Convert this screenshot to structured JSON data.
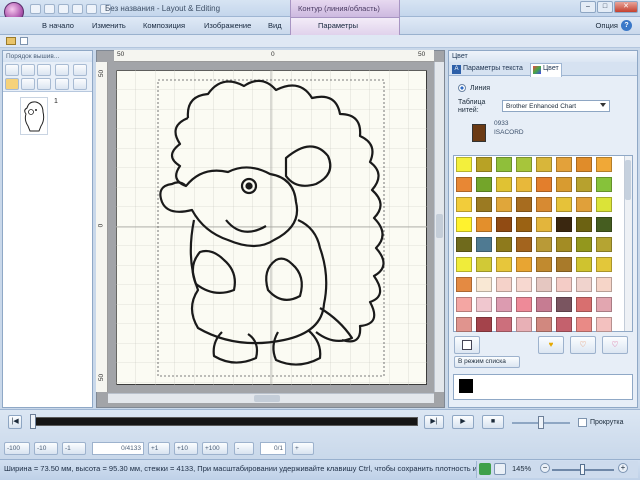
{
  "window": {
    "title": "Без названия - Layout & Editing",
    "context_tab_group": "Контур (линия/область)"
  },
  "ribbon": {
    "tabs": [
      "В начало",
      "Изменить",
      "Композиция",
      "Изображение",
      "Вид",
      "Параметры"
    ],
    "help_label": "Опция",
    "help_icon": "?"
  },
  "left_panel": {
    "title": "Порядок вышив...",
    "thumbnail_index": "1"
  },
  "rulers": {
    "top_labels": [
      "50",
      "0",
      "50"
    ],
    "left_labels": [
      "50",
      "0",
      "50"
    ]
  },
  "right_panel": {
    "title": "Цвет",
    "tabs": [
      "Параметры текста",
      "Цвет"
    ],
    "radio_label": "Линия",
    "thread_table_label": "Таблица нитей:",
    "thread_table_value": "Brother Enhanced Chart",
    "current_thread": {
      "code": "0933",
      "brand": "ISACORD",
      "color": "#6b3a14"
    },
    "list_mode_button": "В режим списка",
    "selected_color": "#000000",
    "palette": [
      "#f3ef3c",
      "#b8a225",
      "#8fbf3a",
      "#a7c53b",
      "#d8b63a",
      "#e3a13a",
      "#e08c2a",
      "#f0a837",
      "#e88734",
      "#73a52a",
      "#e0c233",
      "#e8b83a",
      "#e37e2c",
      "#d89b30",
      "#b7a12e",
      "#86c23a",
      "#f2cc3a",
      "#9b7a22",
      "#e0a63a",
      "#a76c1f",
      "#d78a32",
      "#e6c239",
      "#e0a03a",
      "#dbe338",
      "#fff22e",
      "#e38f2c",
      "#914b13",
      "#9b6213",
      "#e3b53c",
      "#3a2710",
      "#6c6212",
      "#455d20",
      "#6f6a1c",
      "#4f7a92",
      "#8e7a1c",
      "#a3641e",
      "#b99a37",
      "#a38c24",
      "#93971d",
      "#b5a432",
      "#f0ec3a",
      "#d1c936",
      "#e7c63b",
      "#e8a532",
      "#c18a2f",
      "#a87a2a",
      "#cfc32f",
      "#e3c73a",
      "#e48a42",
      "#f9e8d4",
      "#f5d2c9",
      "#f7d8d0",
      "#e5c7c1",
      "#f4ccc6",
      "#f0d3cd",
      "#f6d5c8",
      "#f4a6a3",
      "#f0c7cf",
      "#dc9bb0",
      "#ee8a98",
      "#c67c92",
      "#7a5560",
      "#d86f6f",
      "#e2a6b0",
      "#e0948e",
      "#a4434b",
      "#cc6f7c",
      "#e8b0b6",
      "#d1887f",
      "#c4616d",
      "#e98a86",
      "#f3c1bf"
    ],
    "swatch_buttons": [
      "♥",
      "♡",
      "♡"
    ]
  },
  "playback": {
    "step_buttons": [
      "-100",
      "-10",
      "-1",
      "+1",
      "+10",
      "+100",
      "-",
      "+"
    ],
    "stitch_total": "0/4133",
    "frame_total": "0/1",
    "scroll_label": "Прокрутка"
  },
  "status": {
    "text": "Ширина = 73.50 мм, высота = 95.30 мм, стежки = 4133, При масштабировании удерживайте клавишу Ctrl, чтобы сохранить плотность и ...",
    "zoom": "145%"
  }
}
